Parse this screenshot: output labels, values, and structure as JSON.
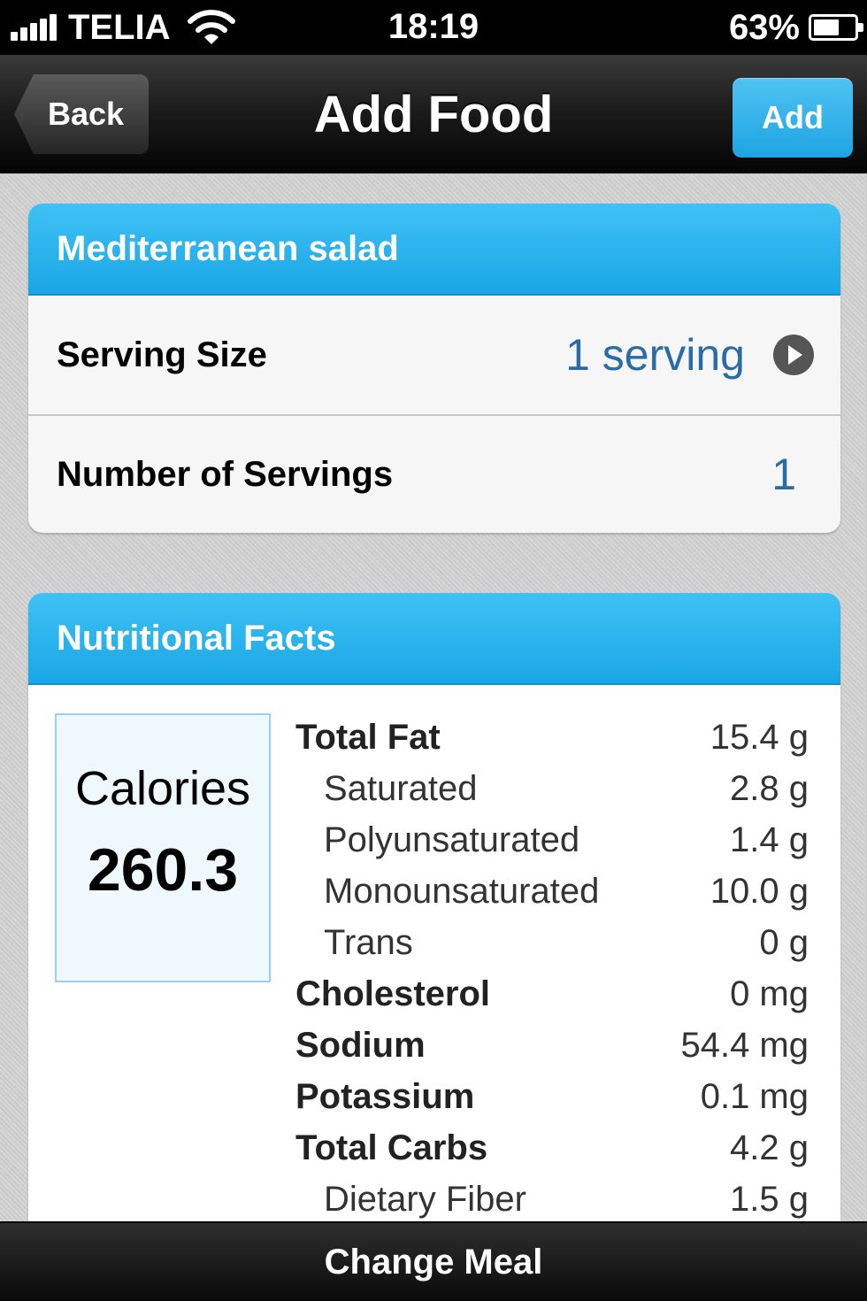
{
  "status_bar": {
    "carrier": "TELIA",
    "time": "18:19",
    "battery_percent": "63%",
    "battery_level": 0.63,
    "signal_bars": 5
  },
  "nav": {
    "back_label": "Back",
    "title": "Add Food",
    "add_label": "Add"
  },
  "food": {
    "name": "Mediterranean salad",
    "serving_size_label": "Serving Size",
    "serving_size_value": "1 serving",
    "servings_label": "Number of Servings",
    "servings_value": "1"
  },
  "nutrition": {
    "header": "Nutritional Facts",
    "calories_label": "Calories",
    "calories_value": "260.3",
    "items": [
      {
        "name": "Total Fat",
        "value": "15.4 g",
        "level": "main"
      },
      {
        "name": "Saturated",
        "value": "2.8 g",
        "level": "sub"
      },
      {
        "name": "Polyunsaturated",
        "value": "1.4 g",
        "level": "sub"
      },
      {
        "name": "Monounsaturated",
        "value": "10.0 g",
        "level": "sub"
      },
      {
        "name": "Trans",
        "value": "0 g",
        "level": "sub"
      },
      {
        "name": "Cholesterol",
        "value": "0 mg",
        "level": "main"
      },
      {
        "name": "Sodium",
        "value": "54.4 mg",
        "level": "main"
      },
      {
        "name": "Potassium",
        "value": "0.1 mg",
        "level": "main"
      },
      {
        "name": "Total Carbs",
        "value": "4.2 g",
        "level": "main"
      },
      {
        "name": "Dietary Fiber",
        "value": "1.5 g",
        "level": "sub"
      }
    ]
  },
  "bottom_bar": {
    "label": "Change Meal"
  },
  "colors": {
    "accent": "#1ea4e3",
    "value_blue": "#2a6ca8"
  }
}
